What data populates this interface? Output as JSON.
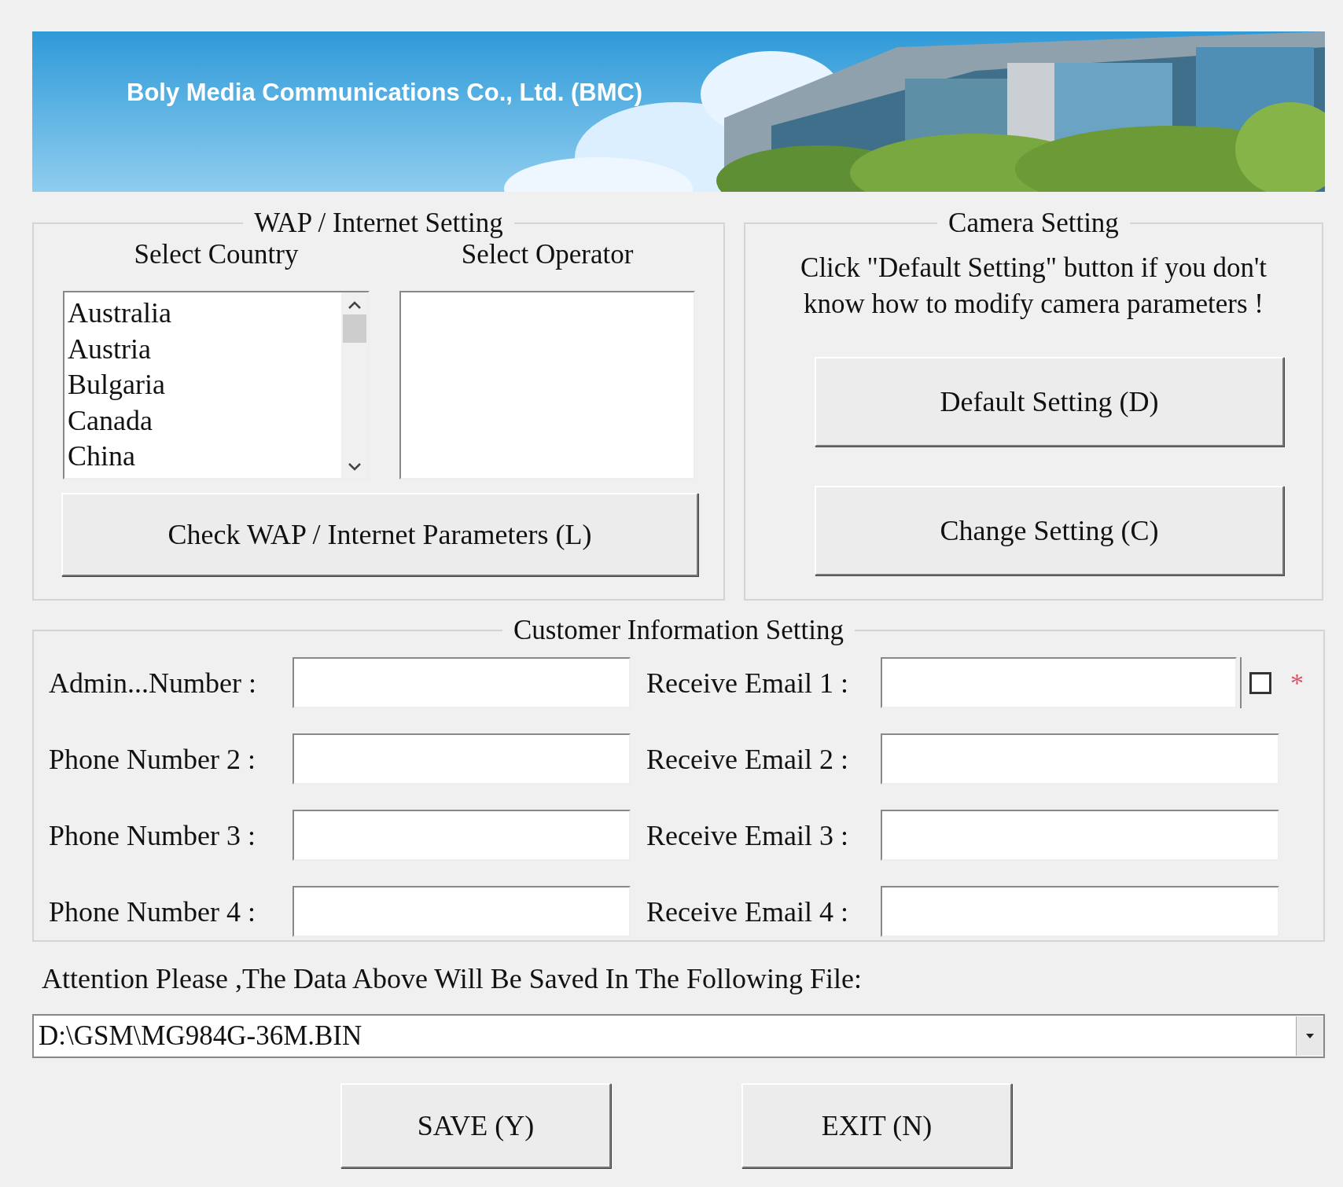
{
  "banner": {
    "title": "Boly Media Communications Co., Ltd. (BMC)"
  },
  "wap_group": {
    "title": "WAP / Internet Setting",
    "country_label": "Select Country",
    "operator_label": "Select Operator",
    "countries": [
      {
        "label": "Australia",
        "selected": false
      },
      {
        "label": "Austria",
        "selected": false
      },
      {
        "label": "Bulgaria",
        "selected": false
      },
      {
        "label": "Canada",
        "selected": false
      },
      {
        "label": "China",
        "selected": false
      }
    ],
    "button": "Check WAP / Internet Parameters (L)"
  },
  "camera_group": {
    "title": "Camera Setting",
    "note": "Click \"Default Setting\" button if you don't know how to modify camera parameters !",
    "buttons": [
      "Default Setting (D)",
      "Change Setting (C)"
    ]
  },
  "customer_group": {
    "title": "Customer Information Setting",
    "rows": [
      {
        "phone_label": "Admin...Number :",
        "email_label": "Receive Email 1 :",
        "checkbox": {
          "checked": false
        },
        "required_mark": "*"
      },
      {
        "phone_label": "Phone Number 2 :",
        "email_label": "Receive Email 2 :"
      },
      {
        "phone_label": "Phone Number 3 :",
        "email_label": "Receive Email 3 :"
      },
      {
        "phone_label": "Phone Number 4 :",
        "email_label": "Receive Email 4 :"
      }
    ]
  },
  "attention": "Attention Please ,The Data Above Will Be Saved In The Following  File:",
  "file_combo": {
    "value": "D:\\GSM\\MG984G-36M.BIN"
  },
  "buttons": [
    "SAVE (Y)",
    "EXIT (N)"
  ]
}
